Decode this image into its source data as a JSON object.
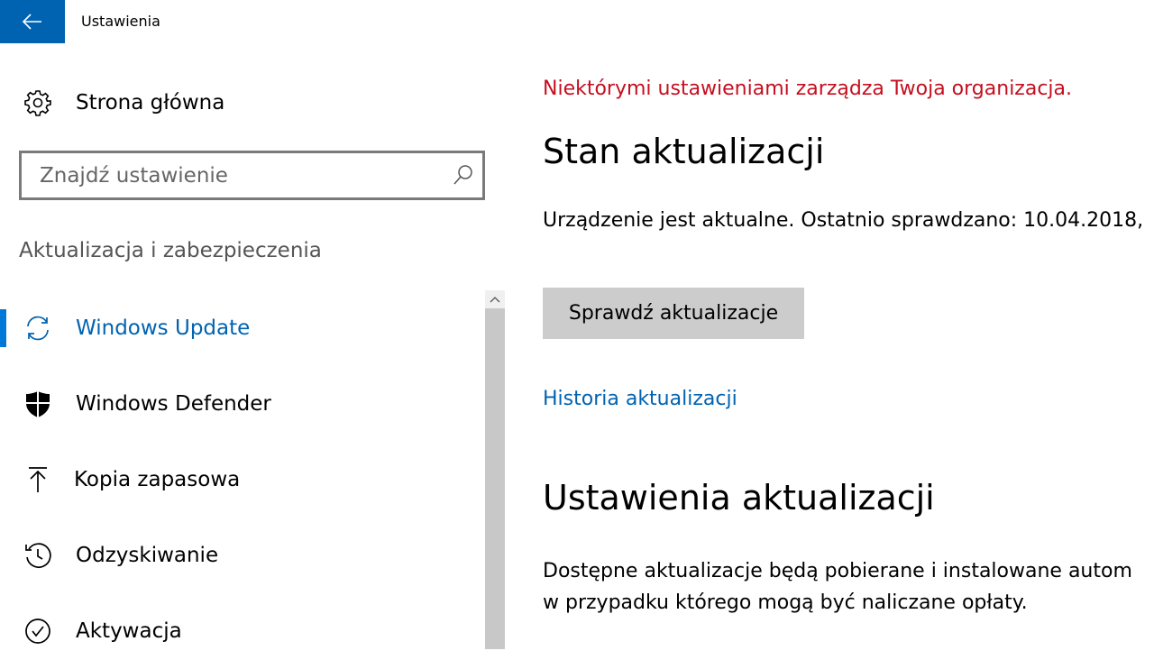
{
  "titlebar": {
    "title": "Ustawienia",
    "accent_color": "#0063b1"
  },
  "sidebar": {
    "home_label": "Strona główna",
    "search_placeholder": "Znajdź ustawienie",
    "section_label": "Aktualizacja i zabezpieczenia",
    "items": [
      {
        "label": "Windows Update",
        "icon": "sync-icon",
        "active": true
      },
      {
        "label": "Windows Defender",
        "icon": "shield-icon",
        "active": false
      },
      {
        "label": "Kopia zapasowa",
        "icon": "upload-arrow-icon",
        "active": false
      },
      {
        "label": "Odzyskiwanie",
        "icon": "history-icon",
        "active": false
      },
      {
        "label": "Aktywacja",
        "icon": "check-circle-icon",
        "active": false
      }
    ]
  },
  "main": {
    "org_notice": "Niektórymi ustawieniami zarządza Twoja organizacja.",
    "org_notice_color": "#c50f1f",
    "status_heading": "Stan aktualizacji",
    "status_text": "Urządzenie jest aktualne. Ostatnio sprawdzano: 10.04.2018,",
    "check_button": "Sprawdź aktualizacje",
    "history_link": "Historia aktualizacji",
    "settings_heading": "Ustawienia aktualizacji",
    "desc_line1": "Dostępne aktualizacje będą pobierane i instalowane autom",
    "desc_line2": "w przypadku którego mogą być naliczane opłaty."
  }
}
